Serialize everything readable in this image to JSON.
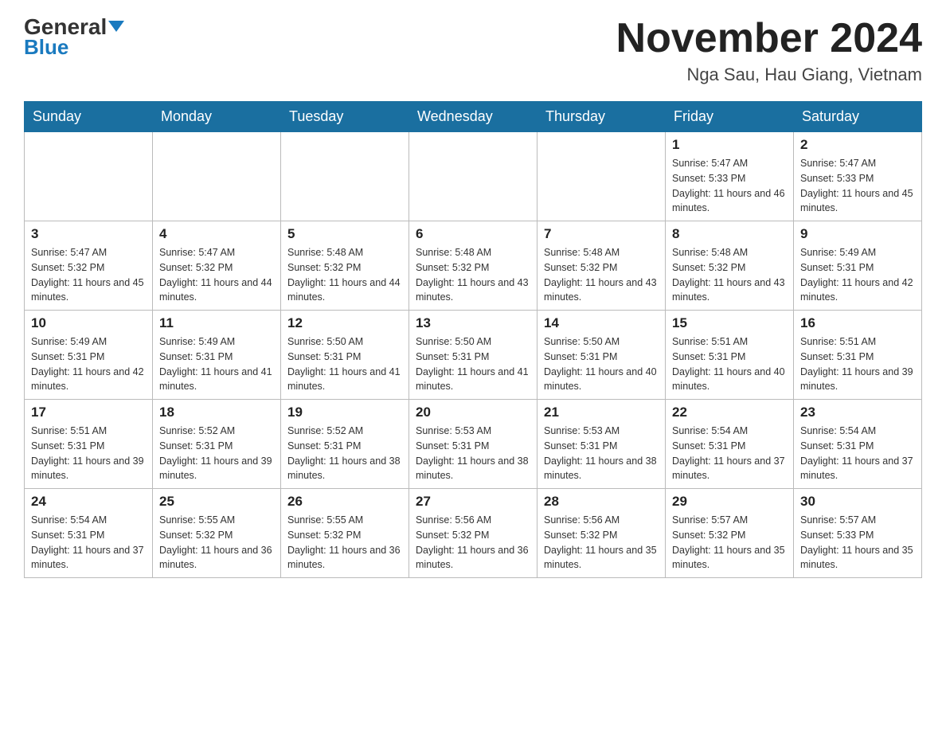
{
  "header": {
    "logo_general": "General",
    "logo_blue": "Blue",
    "month_title": "November 2024",
    "location": "Nga Sau, Hau Giang, Vietnam"
  },
  "days_of_week": [
    "Sunday",
    "Monday",
    "Tuesday",
    "Wednesday",
    "Thursday",
    "Friday",
    "Saturday"
  ],
  "weeks": [
    [
      {
        "day": "",
        "info": ""
      },
      {
        "day": "",
        "info": ""
      },
      {
        "day": "",
        "info": ""
      },
      {
        "day": "",
        "info": ""
      },
      {
        "day": "",
        "info": ""
      },
      {
        "day": "1",
        "info": "Sunrise: 5:47 AM\nSunset: 5:33 PM\nDaylight: 11 hours and 46 minutes."
      },
      {
        "day": "2",
        "info": "Sunrise: 5:47 AM\nSunset: 5:33 PM\nDaylight: 11 hours and 45 minutes."
      }
    ],
    [
      {
        "day": "3",
        "info": "Sunrise: 5:47 AM\nSunset: 5:32 PM\nDaylight: 11 hours and 45 minutes."
      },
      {
        "day": "4",
        "info": "Sunrise: 5:47 AM\nSunset: 5:32 PM\nDaylight: 11 hours and 44 minutes."
      },
      {
        "day": "5",
        "info": "Sunrise: 5:48 AM\nSunset: 5:32 PM\nDaylight: 11 hours and 44 minutes."
      },
      {
        "day": "6",
        "info": "Sunrise: 5:48 AM\nSunset: 5:32 PM\nDaylight: 11 hours and 43 minutes."
      },
      {
        "day": "7",
        "info": "Sunrise: 5:48 AM\nSunset: 5:32 PM\nDaylight: 11 hours and 43 minutes."
      },
      {
        "day": "8",
        "info": "Sunrise: 5:48 AM\nSunset: 5:32 PM\nDaylight: 11 hours and 43 minutes."
      },
      {
        "day": "9",
        "info": "Sunrise: 5:49 AM\nSunset: 5:31 PM\nDaylight: 11 hours and 42 minutes."
      }
    ],
    [
      {
        "day": "10",
        "info": "Sunrise: 5:49 AM\nSunset: 5:31 PM\nDaylight: 11 hours and 42 minutes."
      },
      {
        "day": "11",
        "info": "Sunrise: 5:49 AM\nSunset: 5:31 PM\nDaylight: 11 hours and 41 minutes."
      },
      {
        "day": "12",
        "info": "Sunrise: 5:50 AM\nSunset: 5:31 PM\nDaylight: 11 hours and 41 minutes."
      },
      {
        "day": "13",
        "info": "Sunrise: 5:50 AM\nSunset: 5:31 PM\nDaylight: 11 hours and 41 minutes."
      },
      {
        "day": "14",
        "info": "Sunrise: 5:50 AM\nSunset: 5:31 PM\nDaylight: 11 hours and 40 minutes."
      },
      {
        "day": "15",
        "info": "Sunrise: 5:51 AM\nSunset: 5:31 PM\nDaylight: 11 hours and 40 minutes."
      },
      {
        "day": "16",
        "info": "Sunrise: 5:51 AM\nSunset: 5:31 PM\nDaylight: 11 hours and 39 minutes."
      }
    ],
    [
      {
        "day": "17",
        "info": "Sunrise: 5:51 AM\nSunset: 5:31 PM\nDaylight: 11 hours and 39 minutes."
      },
      {
        "day": "18",
        "info": "Sunrise: 5:52 AM\nSunset: 5:31 PM\nDaylight: 11 hours and 39 minutes."
      },
      {
        "day": "19",
        "info": "Sunrise: 5:52 AM\nSunset: 5:31 PM\nDaylight: 11 hours and 38 minutes."
      },
      {
        "day": "20",
        "info": "Sunrise: 5:53 AM\nSunset: 5:31 PM\nDaylight: 11 hours and 38 minutes."
      },
      {
        "day": "21",
        "info": "Sunrise: 5:53 AM\nSunset: 5:31 PM\nDaylight: 11 hours and 38 minutes."
      },
      {
        "day": "22",
        "info": "Sunrise: 5:54 AM\nSunset: 5:31 PM\nDaylight: 11 hours and 37 minutes."
      },
      {
        "day": "23",
        "info": "Sunrise: 5:54 AM\nSunset: 5:31 PM\nDaylight: 11 hours and 37 minutes."
      }
    ],
    [
      {
        "day": "24",
        "info": "Sunrise: 5:54 AM\nSunset: 5:31 PM\nDaylight: 11 hours and 37 minutes."
      },
      {
        "day": "25",
        "info": "Sunrise: 5:55 AM\nSunset: 5:32 PM\nDaylight: 11 hours and 36 minutes."
      },
      {
        "day": "26",
        "info": "Sunrise: 5:55 AM\nSunset: 5:32 PM\nDaylight: 11 hours and 36 minutes."
      },
      {
        "day": "27",
        "info": "Sunrise: 5:56 AM\nSunset: 5:32 PM\nDaylight: 11 hours and 36 minutes."
      },
      {
        "day": "28",
        "info": "Sunrise: 5:56 AM\nSunset: 5:32 PM\nDaylight: 11 hours and 35 minutes."
      },
      {
        "day": "29",
        "info": "Sunrise: 5:57 AM\nSunset: 5:32 PM\nDaylight: 11 hours and 35 minutes."
      },
      {
        "day": "30",
        "info": "Sunrise: 5:57 AM\nSunset: 5:33 PM\nDaylight: 11 hours and 35 minutes."
      }
    ]
  ]
}
